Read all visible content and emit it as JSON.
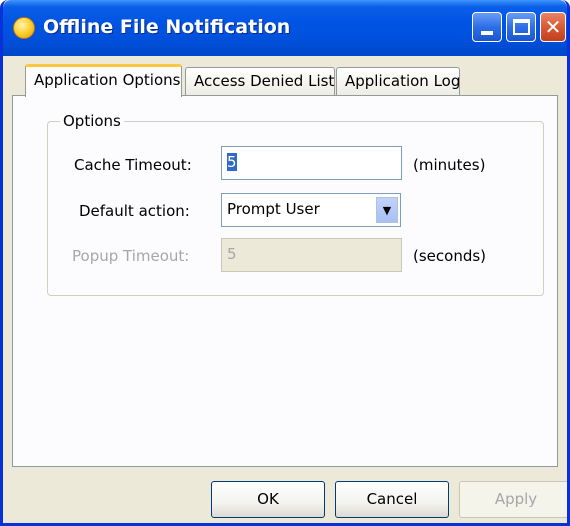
{
  "window": {
    "title": "Offline File Notification"
  },
  "tabs": [
    {
      "label": "Application Options",
      "active": true
    },
    {
      "label": "Access Denied List",
      "active": false
    },
    {
      "label": "Application Log",
      "active": false
    }
  ],
  "options": {
    "group_label": "Options",
    "cache_timeout": {
      "label": "Cache Timeout:",
      "value": "5",
      "unit": "(minutes)"
    },
    "default_action": {
      "label": "Default action:",
      "value": "Prompt User"
    },
    "popup_timeout": {
      "label": "Popup Timeout:",
      "value": "5",
      "unit": "(seconds)",
      "disabled": true
    }
  },
  "buttons": {
    "ok": "OK",
    "cancel": "Cancel",
    "apply": "Apply"
  }
}
